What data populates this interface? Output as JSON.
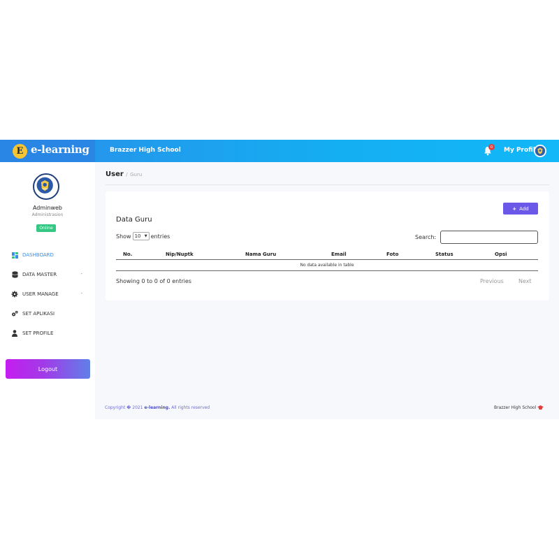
{
  "brand": {
    "badge": "E",
    "name": "e-learning"
  },
  "header": {
    "school": "Brazzer High School",
    "notifications": "0",
    "profile_label": "My Profile"
  },
  "sidebar": {
    "user_name": "Adminweb",
    "user_role": "Administrasion",
    "status": "Online",
    "items": [
      {
        "label": "DASHBOARD",
        "icon": "dashboard-icon"
      },
      {
        "label": "DATA MASTER",
        "icon": "database-icon"
      },
      {
        "label": "USER MANAGE",
        "icon": "gear-icon"
      },
      {
        "label": "SET APLIKASI",
        "icon": "gears-icon"
      },
      {
        "label": "SET PROFILE",
        "icon": "user-icon"
      }
    ],
    "caret": "-",
    "logout": "Logout"
  },
  "breadcrumb": {
    "main": "User",
    "sep": "/",
    "sub": "Guru"
  },
  "card": {
    "add_label": "Add",
    "title": "Data Guru",
    "show_label": "Show",
    "entries_value": "10",
    "entries_label": "entries",
    "search_label": "Search:",
    "columns": [
      "No.",
      "Nip/Nuptk",
      "Nama Guru",
      "Email",
      "Foto",
      "Status",
      "Opsi"
    ],
    "empty_text": "No data available in table",
    "info": "Showing 0 to 0 of 0 entries",
    "previous": "Previous",
    "next": "Next"
  },
  "footer": {
    "copyright_prefix": "Copyright � 2021",
    "copyright_brand": "e-learning.",
    "copyright_suffix": "All rights reserved",
    "school": "Brazzer High School"
  },
  "colors": {
    "accent": "#6b57e8",
    "topbar": "#14aef2",
    "online": "#35c784",
    "active": "#3a8ee6"
  }
}
